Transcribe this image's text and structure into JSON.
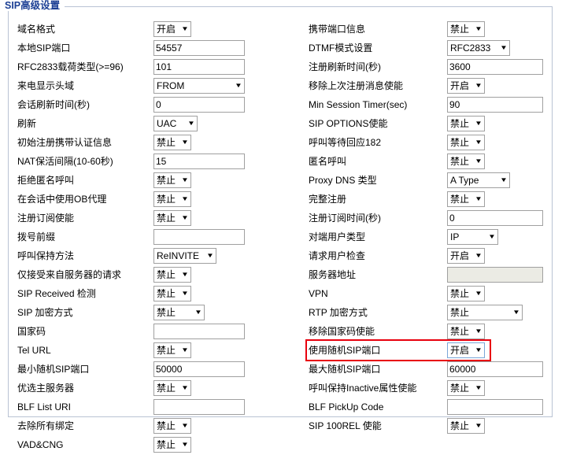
{
  "page": {
    "title": "SIP高级设置"
  },
  "options": {
    "enable": "开启",
    "disable": "禁止"
  },
  "left_column": [
    {
      "label": "域名格式",
      "type": "select",
      "value": "开启",
      "size": "w-xs"
    },
    {
      "label": "本地SIP端口",
      "type": "text",
      "value": "54557"
    },
    {
      "label": "RFC2833载荷类型(>=96)",
      "type": "text",
      "value": "101"
    },
    {
      "label": "来电显示头域",
      "type": "select",
      "value": "FROM",
      "size": "w-full"
    },
    {
      "label": "会话刷新时间(秒)",
      "type": "text",
      "value": "0"
    },
    {
      "label": "刷新",
      "type": "select",
      "value": "UAC",
      "size": "w-sm"
    },
    {
      "label": "初始注册携带认证信息",
      "type": "select",
      "value": "禁止",
      "size": "w-xs"
    },
    {
      "label": "NAT保活间隔(10-60秒)",
      "type": "text",
      "value": "15"
    },
    {
      "label": "拒绝匿名呼叫",
      "type": "select",
      "value": "禁止",
      "size": "w-xs"
    },
    {
      "label": "在会话中使用OB代理",
      "type": "select",
      "value": "禁止",
      "size": "w-xs"
    },
    {
      "label": "注册订阅使能",
      "type": "select",
      "value": "禁止",
      "size": "w-xs"
    },
    {
      "label": "拨号前缀",
      "type": "text",
      "value": ""
    },
    {
      "label": "呼叫保持方法",
      "type": "select",
      "value": "ReINVITE",
      "size": "w-xl"
    },
    {
      "label": "仅接受来自服务器的请求",
      "type": "select",
      "value": "禁止",
      "size": "w-xs"
    },
    {
      "label": "SIP Received 检测",
      "type": "select",
      "value": "禁止",
      "size": "w-xs"
    },
    {
      "label": "SIP 加密方式",
      "type": "select",
      "value": "禁止",
      "size": "w-md"
    },
    {
      "label": "国家码",
      "type": "text",
      "value": ""
    },
    {
      "label": "Tel URL",
      "type": "select",
      "value": "禁止",
      "size": "w-xs"
    },
    {
      "label": "最小随机SIP端口",
      "type": "text",
      "value": "50000"
    },
    {
      "label": "优选主服务器",
      "type": "select",
      "value": "禁止",
      "size": "w-xs"
    },
    {
      "label": "BLF List URI",
      "type": "text",
      "value": ""
    },
    {
      "label": "去除所有绑定",
      "type": "select",
      "value": "禁止",
      "size": "w-xs"
    },
    {
      "label": "VAD&CNG",
      "type": "select",
      "value": "禁止",
      "size": "w-xs"
    }
  ],
  "right_column": [
    {
      "label": "携带端口信息",
      "type": "select",
      "value": "禁止",
      "size": "w-xs"
    },
    {
      "label": "DTMF模式设置",
      "type": "select",
      "value": "RFC2833",
      "size": "w-xl"
    },
    {
      "label": "注册刷新时间(秒)",
      "type": "text",
      "value": "3600"
    },
    {
      "label": "移除上次注册消息使能",
      "type": "select",
      "value": "开启",
      "size": "w-xs"
    },
    {
      "label": "Min Session Timer(sec)",
      "type": "text",
      "value": "90"
    },
    {
      "label": "SIP OPTIONS使能",
      "type": "select",
      "value": "禁止",
      "size": "w-xs"
    },
    {
      "label": "呼叫等待回应182",
      "type": "select",
      "value": "禁止",
      "size": "w-xs"
    },
    {
      "label": "匿名呼叫",
      "type": "select",
      "value": "禁止",
      "size": "w-xs"
    },
    {
      "label": "Proxy DNS 类型",
      "type": "select",
      "value": "A Type",
      "size": "w-xl"
    },
    {
      "label": "完整注册",
      "type": "select",
      "value": "禁止",
      "size": "w-xs"
    },
    {
      "label": "注册订阅时间(秒)",
      "type": "text",
      "value": "0"
    },
    {
      "label": "对端用户类型",
      "type": "select",
      "value": "IP",
      "size": "w-md"
    },
    {
      "label": "请求用户检查",
      "type": "select",
      "value": "开启",
      "size": "w-xs"
    },
    {
      "label": "服务器地址",
      "type": "text",
      "value": "",
      "disabled": true
    },
    {
      "label": "VPN",
      "type": "select",
      "value": "禁止",
      "size": "w-xs"
    },
    {
      "label": "RTP 加密方式",
      "type": "select",
      "value": "禁止",
      "size": "w-xxl"
    },
    {
      "label": "移除国家码使能",
      "type": "select",
      "value": "禁止",
      "size": "w-xs"
    },
    {
      "label": "使用随机SIP端口",
      "type": "select",
      "value": "开启",
      "size": "w-xs",
      "focused": true,
      "highlighted": true
    },
    {
      "label": "最大随机SIP端口",
      "type": "text",
      "value": "60000"
    },
    {
      "label": "呼叫保持Inactive属性使能",
      "type": "select",
      "value": "禁止",
      "size": "w-xs"
    },
    {
      "label": "BLF PickUp Code",
      "type": "text",
      "value": ""
    },
    {
      "label": "SIP 100REL 使能",
      "type": "select",
      "value": "禁止",
      "size": "w-xs"
    }
  ],
  "annotation": {
    "color": "#e8000d",
    "target_label": "使用随机SIP端口"
  }
}
